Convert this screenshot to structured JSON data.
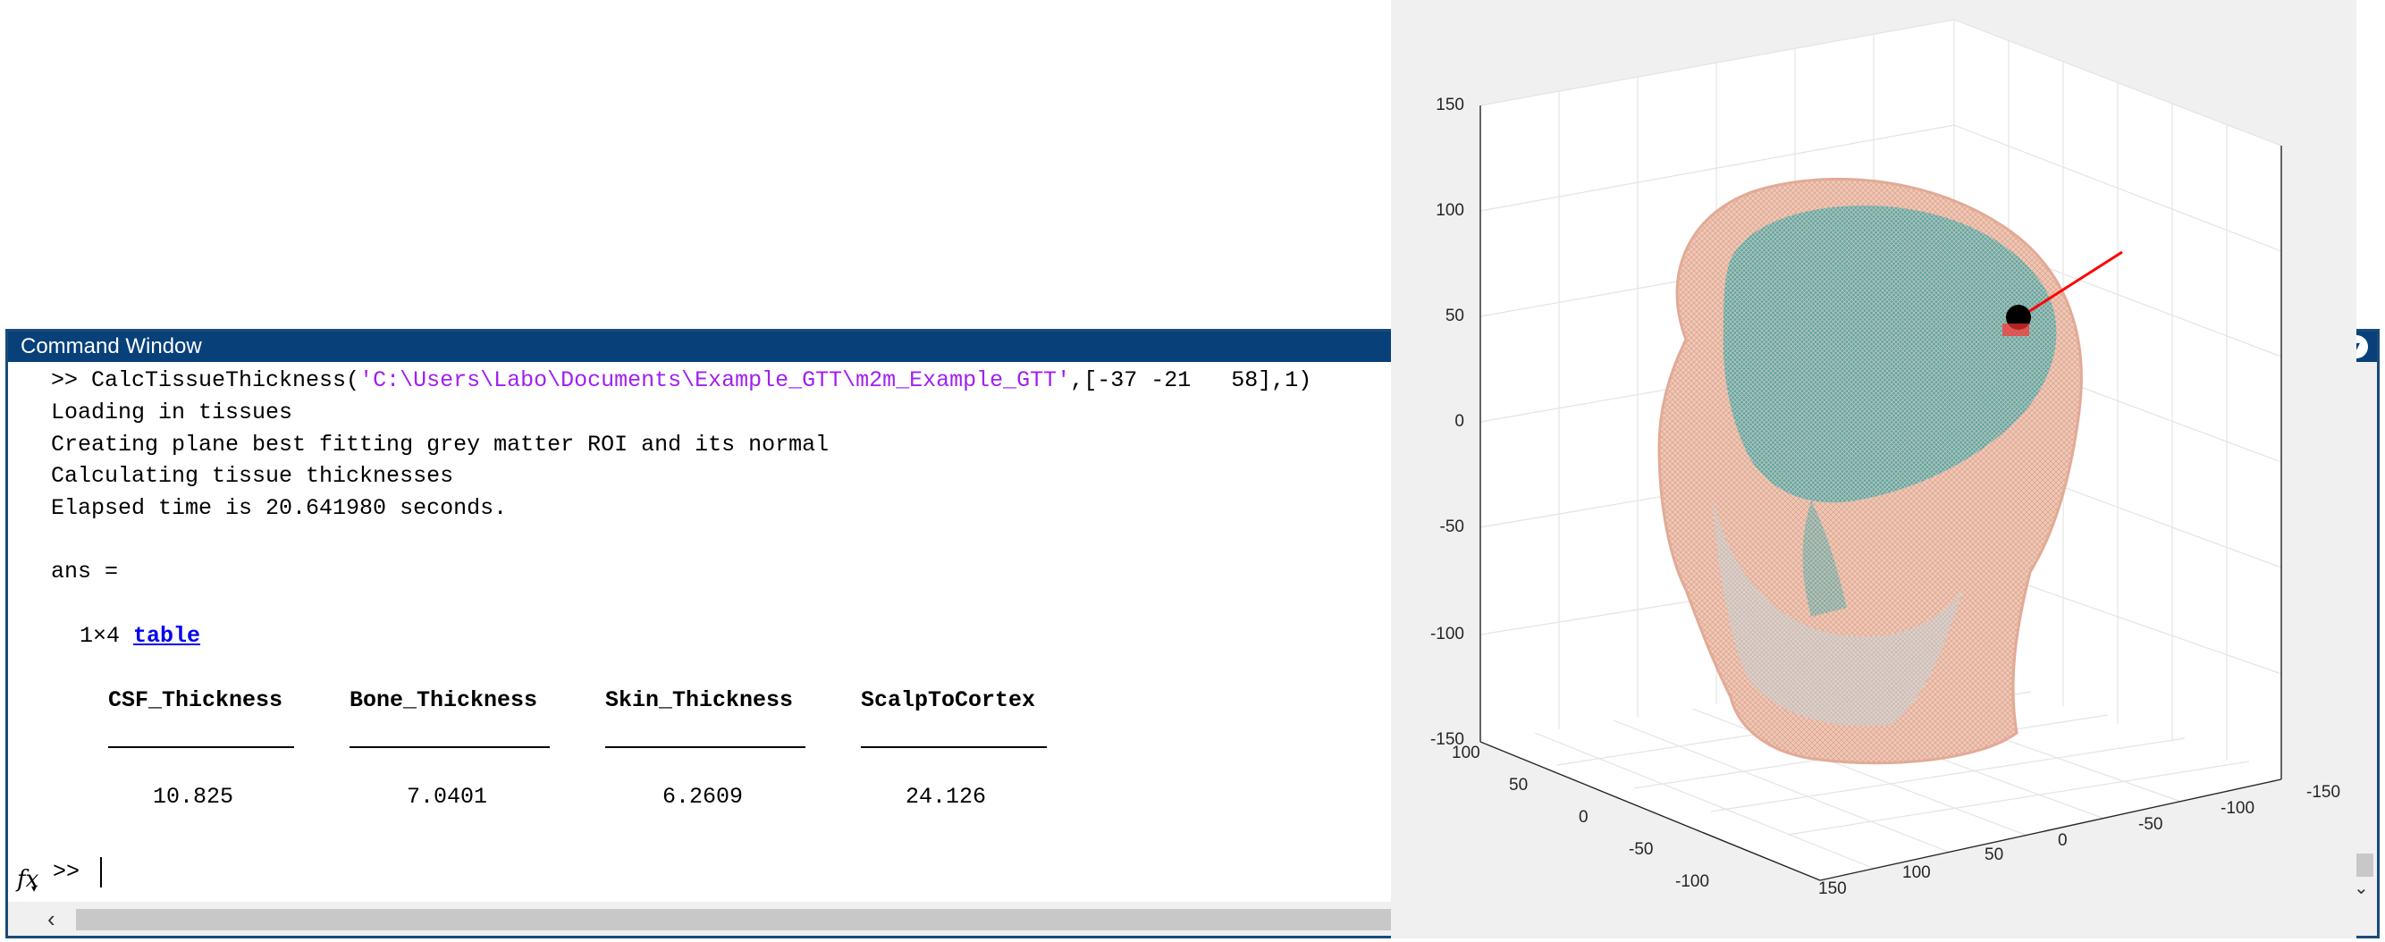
{
  "command_window": {
    "title": "Command Window",
    "menu_icon": "chevron-down-circle-icon",
    "prompt": ">>",
    "command_prefix": ">> CalcTissueThickness(",
    "command_path": "'C:\\Users\\Labo\\Documents\\Example_GTT\\m2m_Example_GTT'",
    "command_suffix": ",[-37 -21   58],1)",
    "output_lines": [
      "Loading in tissues",
      "Creating plane best fitting grey matter ROI and its normal",
      "Calculating tissue thicknesses",
      "Elapsed time is 20.641980 seconds."
    ],
    "ans_label": "ans =",
    "table_size": "1×4",
    "table_link": "table",
    "table": {
      "headers": [
        "CSF_Thickness",
        "Bone_Thickness",
        "Skin_Thickness",
        "ScalpToCortex"
      ],
      "values": [
        "10.825",
        "7.0401",
        "6.2609",
        "24.126"
      ]
    },
    "fx_label": "fx"
  },
  "figure": {
    "z_ticks": [
      "150",
      "100",
      "50",
      "0",
      "-50",
      "-100",
      "-150"
    ],
    "y_ticks": [
      "100",
      "50",
      "0",
      "-50",
      "-100"
    ],
    "x_ticks": [
      "150",
      "100",
      "50",
      "0",
      "-50",
      "-100",
      "-150"
    ],
    "colors": {
      "skin": "#e8b8a4",
      "brain": "#3a9a9a",
      "marker_line": "#ff0000"
    }
  },
  "icons": {
    "scroll_left": "‹",
    "scroll_right": "›",
    "scroll_down": "⌄"
  }
}
